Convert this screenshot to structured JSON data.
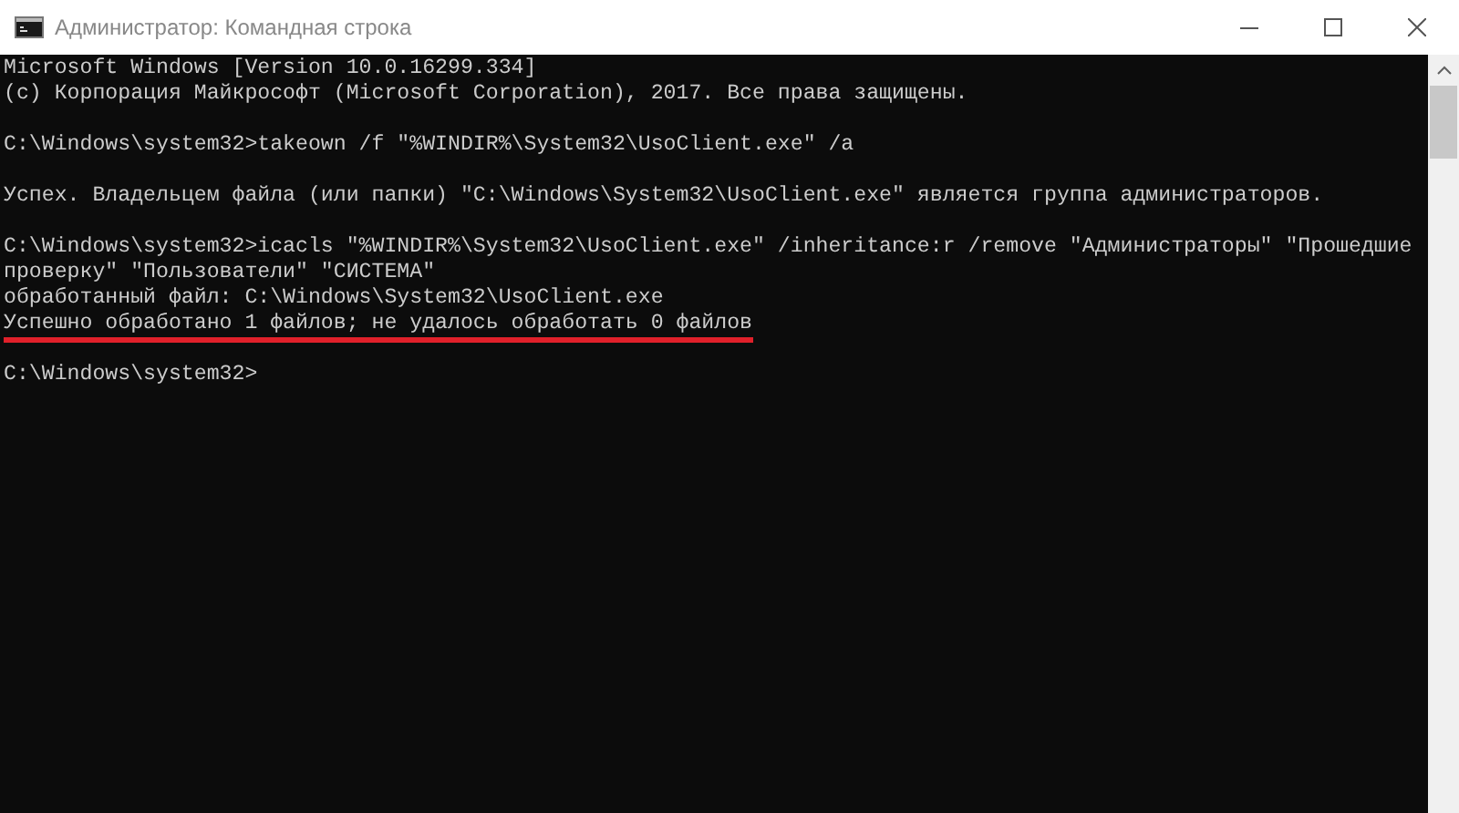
{
  "window": {
    "title": "Администратор: Командная строка"
  },
  "console": {
    "blocks": [
      [
        {
          "text": "Microsoft Windows [Version 10.0.16299.334]",
          "underlined": false
        },
        {
          "text": "(c) Корпорация Майкрософт (Microsoft Corporation), 2017. Все права защищены.",
          "underlined": false
        }
      ],
      [
        {
          "text": "C:\\Windows\\system32>takeown /f \"%WINDIR%\\System32\\UsoClient.exe\" /a",
          "underlined": false
        }
      ],
      [
        {
          "text": "Успех. Владельцем файла (или папки) \"C:\\Windows\\System32\\UsoClient.exe\" является группа администраторов.",
          "underlined": false
        }
      ],
      [
        {
          "text": "C:\\Windows\\system32>icacls \"%WINDIR%\\System32\\UsoClient.exe\" /inheritance:r /remove \"Администраторы\" \"Прошедшие",
          "underlined": false
        },
        {
          "text": "проверку\" \"Пользователи\" \"СИСТЕМА\"",
          "underlined": false
        },
        {
          "text": "обработанный файл: C:\\Windows\\System32\\UsoClient.exe",
          "underlined": false
        },
        {
          "text": "Успешно обработано 1 файлов; не удалось обработать 0 файлов",
          "underlined": true
        }
      ],
      [
        {
          "text": "C:\\Windows\\system32>",
          "underlined": false
        }
      ]
    ]
  }
}
